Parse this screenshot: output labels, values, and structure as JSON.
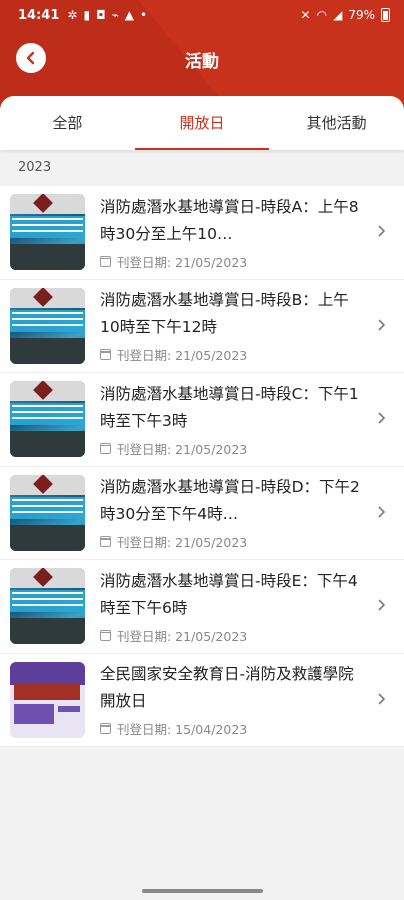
{
  "status": {
    "time": "14:41",
    "battery": "79%"
  },
  "header": {
    "title": "活動",
    "accent": "#c8321d"
  },
  "tabs": [
    {
      "label": "全部",
      "active": false
    },
    {
      "label": "開放日",
      "active": true
    },
    {
      "label": "其他活動",
      "active": false
    }
  ],
  "year": "2023",
  "items": [
    {
      "title": "消防處潛水基地導賞日-時段A：上午8時30分至上午10…",
      "date": "刊登日期: 21/05/2023",
      "thumb": "blue"
    },
    {
      "title": "消防處潛水基地導賞日-時段B：上午10時至下午12時",
      "date": "刊登日期: 21/05/2023",
      "thumb": "blue"
    },
    {
      "title": "消防處潛水基地導賞日-時段C：下午1時至下午3時",
      "date": "刊登日期: 21/05/2023",
      "thumb": "blue"
    },
    {
      "title": "消防處潛水基地導賞日-時段D：下午2時30分至下午4時…",
      "date": "刊登日期: 21/05/2023",
      "thumb": "blue"
    },
    {
      "title": "消防處潛水基地導賞日-時段E：下午4時至下午6時",
      "date": "刊登日期: 21/05/2023",
      "thumb": "blue"
    },
    {
      "title": "全民國家安全教育日-消防及救護學院開放日",
      "date": "刊登日期: 15/04/2023",
      "thumb": "purple"
    }
  ]
}
